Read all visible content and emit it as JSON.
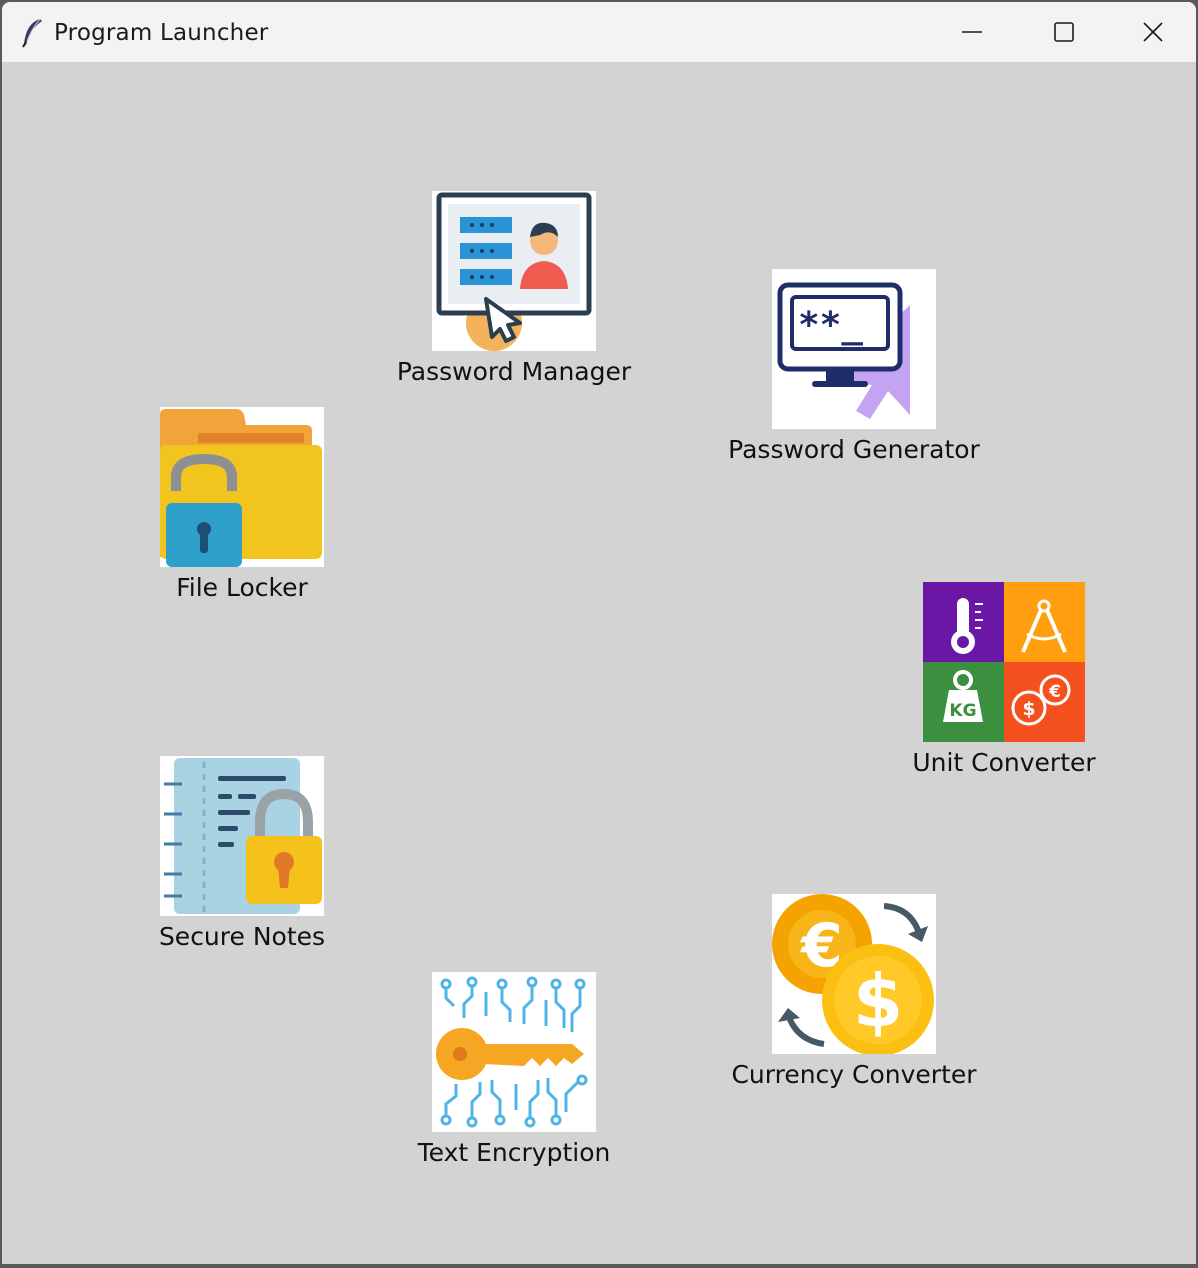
{
  "window": {
    "title": "Program Launcher",
    "app_icon": "feather-icon",
    "controls": [
      "minimize-icon",
      "maximize-icon",
      "close-icon"
    ]
  },
  "launchers": {
    "password_manager": {
      "label": "Password Manager",
      "icon": "password-manager-icon"
    },
    "password_generator": {
      "label": "Password Generator",
      "icon": "password-generator-icon"
    },
    "file_locker": {
      "label": "File Locker",
      "icon": "file-locker-icon"
    },
    "unit_converter": {
      "label": "Unit Converter",
      "icon": "unit-converter-icon"
    },
    "secure_notes": {
      "label": "Secure Notes",
      "icon": "secure-notes-icon"
    },
    "currency_converter": {
      "label": "Currency Converter",
      "icon": "currency-converter-icon"
    },
    "text_encryption": {
      "label": "Text Encryption",
      "icon": "text-encryption-icon"
    }
  },
  "colors": {
    "background": "#d3d3d3",
    "titlebar": "#f3f3f3"
  }
}
